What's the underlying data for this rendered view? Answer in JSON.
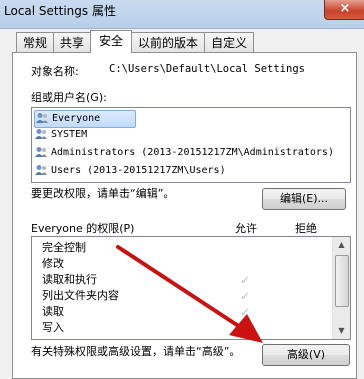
{
  "window": {
    "title": "Local Settings 属性",
    "close_glyph": "×"
  },
  "tabs": [
    {
      "label": "常规"
    },
    {
      "label": "共享"
    },
    {
      "label": "安全"
    },
    {
      "label": "以前的版本"
    },
    {
      "label": "自定义"
    }
  ],
  "security": {
    "object_label": "对象名称:",
    "object_value": "C:\\Users\\Default\\Local Settings",
    "group_label": "组或用户名(G):",
    "users": [
      {
        "name": "Everyone",
        "icon": "user-group-icon"
      },
      {
        "name": "SYSTEM",
        "icon": "user-group-icon"
      },
      {
        "name": "Administrators (2013-20151217ZM\\Administrators)",
        "icon": "user-group-icon"
      },
      {
        "name": "Users (2013-20151217ZM\\Users)",
        "icon": "user-group-icon"
      }
    ],
    "change_hint": "要更改权限，请单击“编辑”。",
    "edit_button": "编辑(E)...",
    "perm_header": "Everyone 的权限(P)",
    "allow_header": "允许",
    "deny_header": "拒绝",
    "permissions": [
      {
        "name": "完全控制",
        "allow": ""
      },
      {
        "name": "修改",
        "allow": ""
      },
      {
        "name": "读取和执行",
        "allow": "✓"
      },
      {
        "name": "列出文件夹内容",
        "allow": "✓"
      },
      {
        "name": "读取",
        "allow": "✓"
      },
      {
        "name": "写入",
        "allow": ""
      }
    ],
    "advanced_hint": "有关特殊权限或高级设置，请单击“高级”。",
    "advanced_button": "高级(V)"
  },
  "colors": {
    "annotation_arrow": "#cc1111"
  }
}
